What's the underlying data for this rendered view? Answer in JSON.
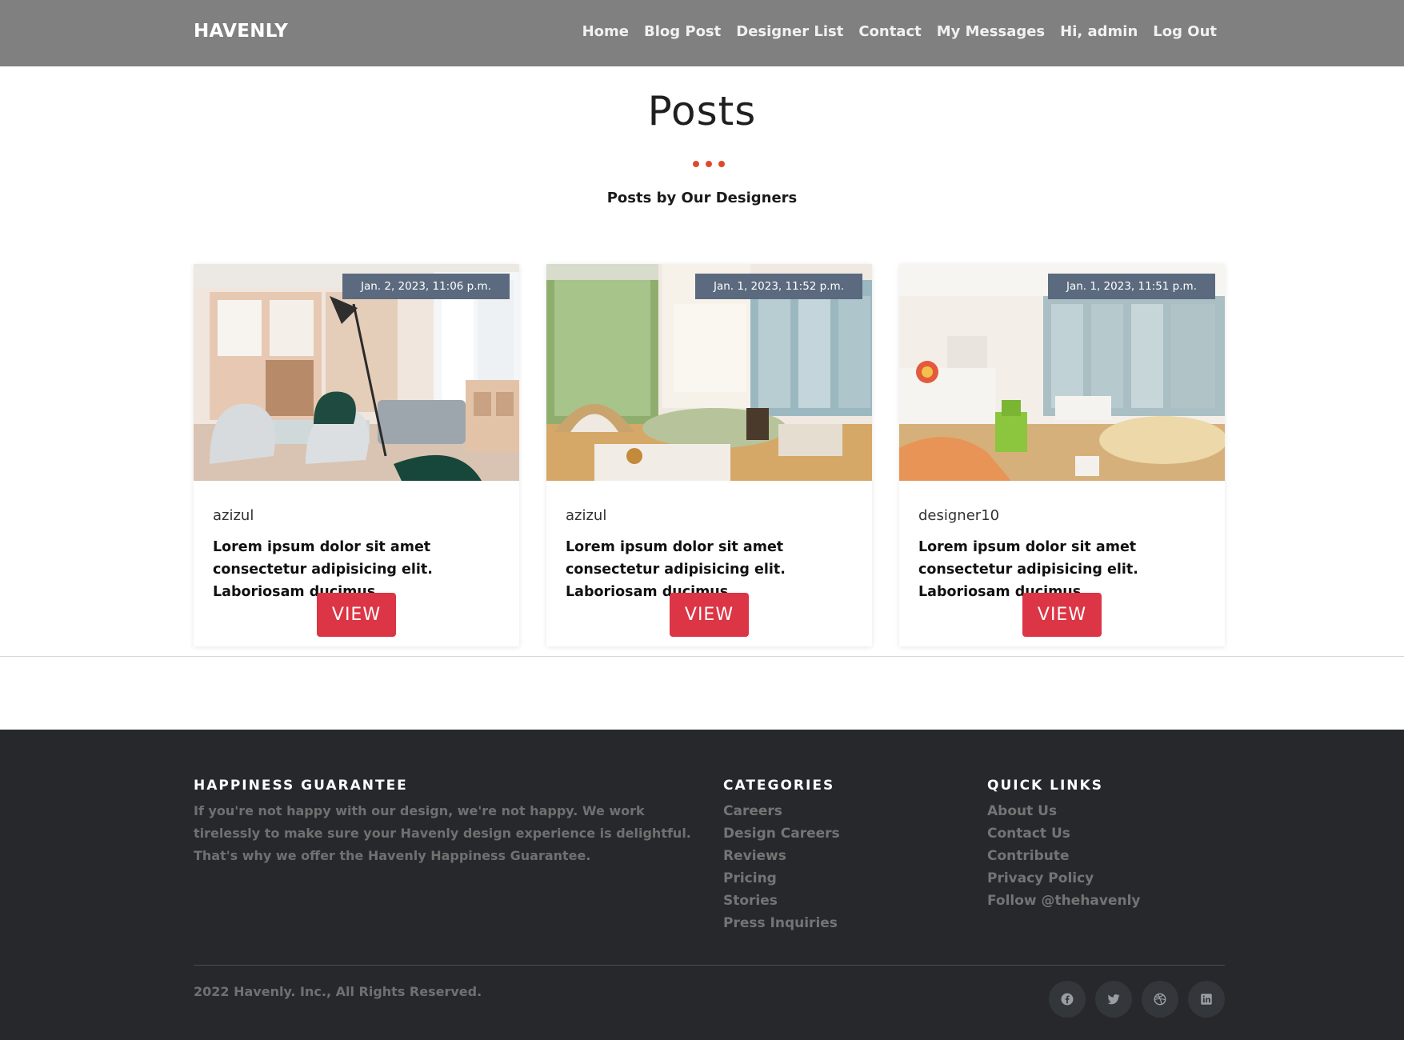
{
  "header": {
    "brand": "HAVENLY",
    "nav": [
      "Home",
      "Blog Post",
      "Designer List",
      "Contact",
      "My Messages",
      "Hi, admin",
      "Log Out"
    ]
  },
  "page": {
    "title": "Posts",
    "subtitle": "Posts by Our Designers"
  },
  "posts": [
    {
      "date": "Jan. 2, 2023, 11:06 p.m.",
      "author": "azizul",
      "excerpt": "Lorem ipsum dolor sit amet consectetur adipisicing elit. Laboriosam ducimus ...",
      "button": "VIEW"
    },
    {
      "date": "Jan. 1, 2023, 11:52 p.m.",
      "author": "azizul",
      "excerpt": "Lorem ipsum dolor sit amet consectetur adipisicing elit. Laboriosam ducimus ...",
      "button": "VIEW"
    },
    {
      "date": "Jan. 1, 2023, 11:51 p.m.",
      "author": "designer10",
      "excerpt": "Lorem ipsum dolor sit amet consectetur adipisicing elit. Laboriosam ducimus ...",
      "button": "VIEW"
    }
  ],
  "footer": {
    "guarantee": {
      "heading": "HAPPINESS GUARANTEE",
      "text": "If you're not happy with our design, we're not happy. We work tirelessly to make sure your Havenly design experience is delightful. That's why we offer the Havenly Happiness Guarantee."
    },
    "categories": {
      "heading": "CATEGORIES",
      "items": [
        "Careers",
        "Design Careers",
        "Reviews",
        "Pricing",
        "Stories",
        "Press Inquiries"
      ]
    },
    "quick_links": {
      "heading": "QUICK LINKS",
      "items": [
        "About Us",
        "Contact Us",
        "Contribute",
        "Privacy Policy",
        "Follow @thehavenly"
      ]
    },
    "copyright": "2022 Havenly. Inc., All Rights Reserved.",
    "socials": [
      "facebook-icon",
      "twitter-icon",
      "dribbble-icon",
      "linkedin-icon"
    ]
  },
  "colors": {
    "navbar": "#808080",
    "accent_dots": "#e0492e",
    "button": "#dc3545",
    "date_badge": "#5b6a7e",
    "footer": "#26282c"
  }
}
